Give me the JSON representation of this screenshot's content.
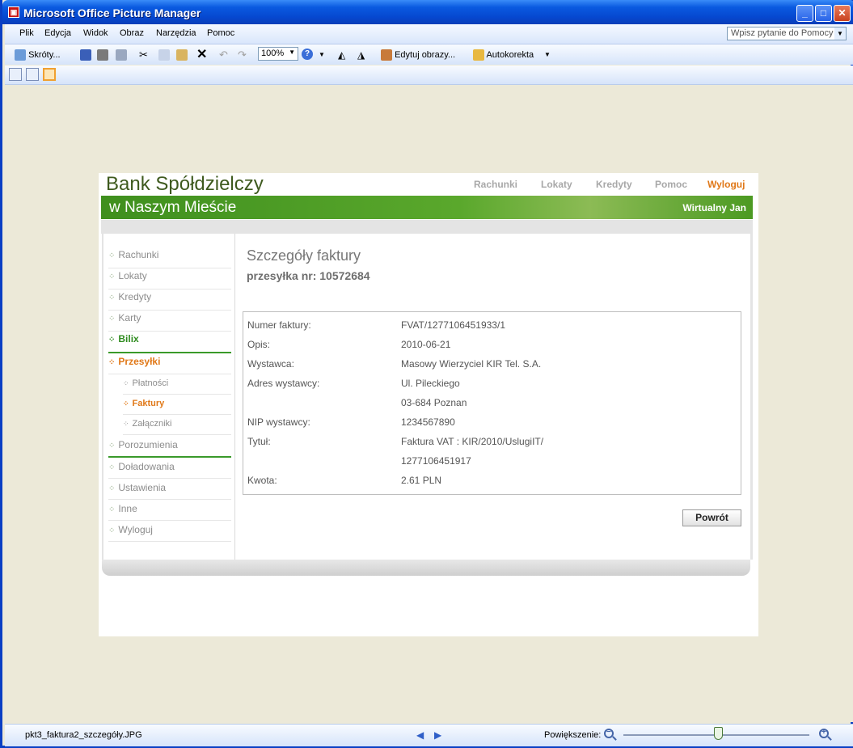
{
  "window": {
    "title": "Microsoft Office Picture Manager",
    "minimize": "_",
    "maximize": "□",
    "close": "✕"
  },
  "menu": {
    "items": [
      "Plik",
      "Edycja",
      "Widok",
      "Obraz",
      "Narzędzia",
      "Pomoc"
    ],
    "help_placeholder": "Wpisz pytanie do Pomocy"
  },
  "toolbar": {
    "shortcuts": "Skróty...",
    "zoom": "100%",
    "edit_images": "Edytuj obrazy...",
    "autocorrect": "Autokorekta"
  },
  "status": {
    "filename": "pkt3_faktura2_szczegóły.JPG",
    "zoom_label": "Powiększenie:",
    "zoom_level": 0.51
  },
  "bank": {
    "name_line1": "Bank Spółdzielczy",
    "name_line2": "w Naszym Mieście",
    "user": "Wirtualny Jan",
    "topnav": [
      "Rachunki",
      "Lokaty",
      "Kredyty",
      "Pomoc",
      "Wyloguj"
    ],
    "sidebar": {
      "rachunki": "Rachunki",
      "lokaty": "Lokaty",
      "kredyty": "Kredyty",
      "karty": "Karty",
      "bilix": "Bilix",
      "przesylki": "Przesyłki",
      "platnosci": "Płatności",
      "faktury": "Faktury",
      "zalaczniki": "Załączniki",
      "porozumienia": "Porozumienia",
      "doladowania": "Doładowania",
      "ustawienia": "Ustawienia",
      "inne": "Inne",
      "wyloguj": "Wyloguj"
    },
    "content": {
      "title": "Szczegóły faktury",
      "subtitle": "przesyłka nr: 10572684",
      "rows": {
        "numer_label": "Numer faktury:",
        "numer_value": "FVAT/1277106451933/1",
        "opis_label": "Opis:",
        "opis_value": "2010-06-21",
        "wystawca_label": "Wystawca:",
        "wystawca_value": "Masowy Wierzyciel KIR Tel. S.A.",
        "adres_label": "Adres wystawcy:",
        "adres_value1": "Ul. Pileckiego",
        "adres_value2": "03-684 Poznan",
        "nip_label": "NIP wystawcy:",
        "nip_value": "1234567890",
        "tytul_label": "Tytuł:",
        "tytul_value1": "Faktura VAT : KIR/2010/UslugiIT/",
        "tytul_value2": "1277106451917",
        "kwota_label": "Kwota:",
        "kwota_value": "2.61 PLN"
      },
      "back_button": "Powrót"
    }
  }
}
